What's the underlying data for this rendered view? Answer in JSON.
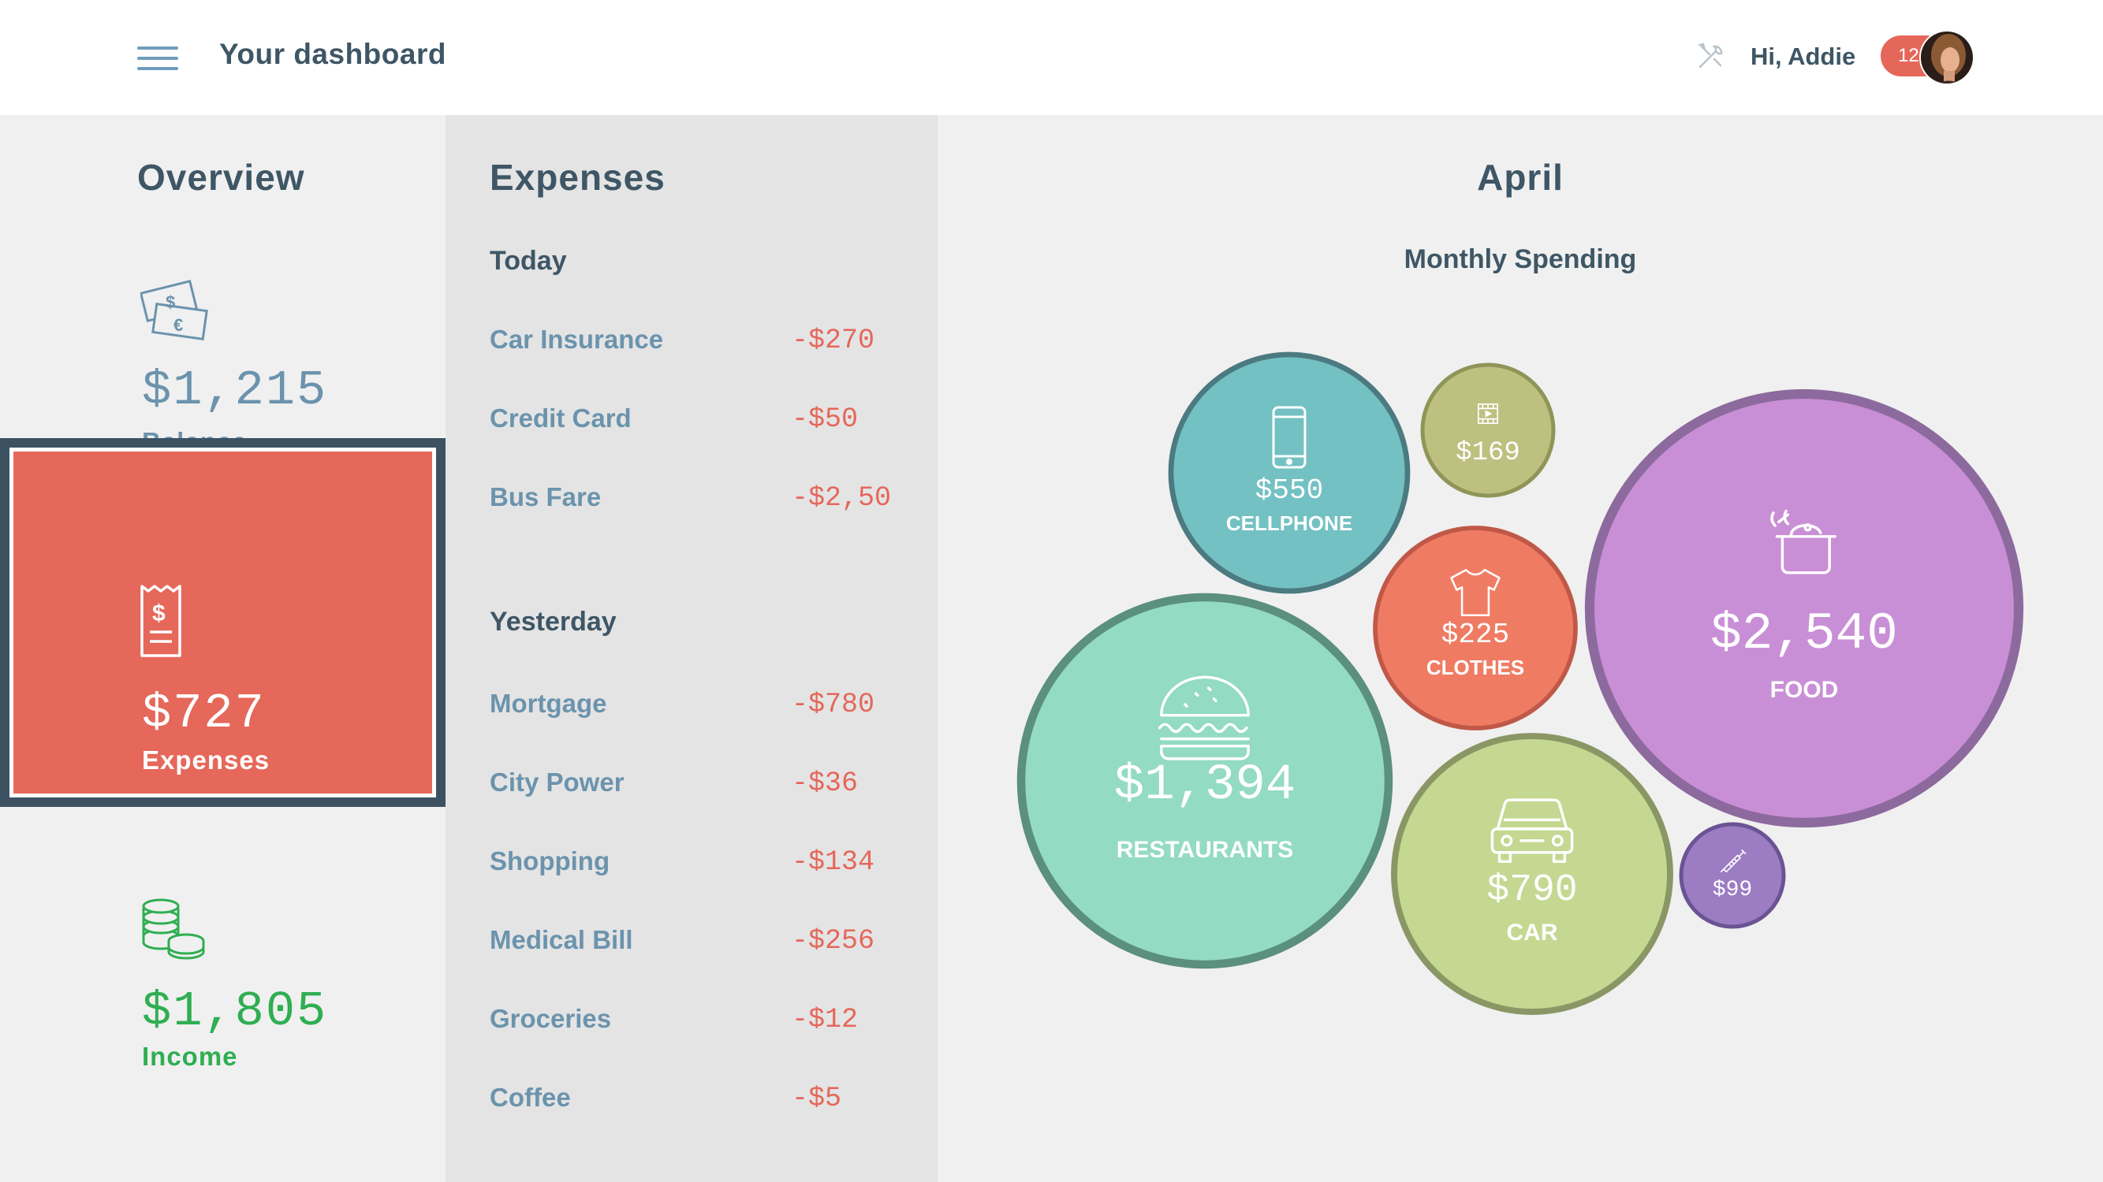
{
  "header": {
    "title": "Your dashboard",
    "greeting": "Hi, Addie",
    "notification_count": "12"
  },
  "overview": {
    "title": "Overview",
    "balance": {
      "value": "$1,215",
      "label": "Balance"
    },
    "expenses": {
      "value": "$727",
      "label": "Expenses"
    },
    "income": {
      "value": "$1,805",
      "label": "Income"
    }
  },
  "expenses": {
    "title": "Expenses",
    "today": {
      "label": "Today",
      "items": [
        {
          "name": "Car Insurance",
          "amount": "-$270"
        },
        {
          "name": "Credit Card",
          "amount": "-$50"
        },
        {
          "name": "Bus Fare",
          "amount": "-$2,50"
        }
      ]
    },
    "yesterday": {
      "label": "Yesterday",
      "items": [
        {
          "name": "Mortgage",
          "amount": "-$780"
        },
        {
          "name": "City Power",
          "amount": "-$36"
        },
        {
          "name": "Shopping",
          "amount": "-$134"
        },
        {
          "name": "Medical Bill",
          "amount": "-$256"
        },
        {
          "name": "Groceries",
          "amount": "-$12"
        },
        {
          "name": "Coffee",
          "amount": "-$5"
        }
      ]
    }
  },
  "chart": {
    "month": "April",
    "subtitle": "Monthly Spending"
  },
  "chart_data": {
    "type": "bubble",
    "title": "Monthly Spending",
    "items": [
      {
        "name": "CELLPHONE",
        "value": 550,
        "label": "$550",
        "icon": "phone-icon",
        "color": "#73c1c2",
        "ring": "#4b7a80"
      },
      {
        "name": "",
        "value": 169,
        "label": "$169",
        "icon": "film-icon",
        "color": "#bec080",
        "ring": "#8f9558"
      },
      {
        "name": "FOOD",
        "value": 2540,
        "label": "$2,540",
        "icon": "cooking-pot-icon",
        "color": "#c98fd6",
        "ring": "#8d6a9e"
      },
      {
        "name": "CLOTHES",
        "value": 225,
        "label": "$225",
        "icon": "shirt-icon",
        "color": "#f07b63",
        "ring": "#c05848"
      },
      {
        "name": "RESTAURANTS",
        "value": 1394,
        "label": "$1,394",
        "icon": "burger-icon",
        "color": "#93dbc3",
        "ring": "#5b8f7e"
      },
      {
        "name": "CAR",
        "value": 790,
        "label": "$790",
        "icon": "car-icon",
        "color": "#c5d892",
        "ring": "#8a9765"
      },
      {
        "name": "",
        "value": 99,
        "label": "$99",
        "icon": "syringe-icon",
        "color": "#9c7cc3",
        "ring": "#6a5494"
      }
    ]
  },
  "colors": {
    "accent_red": "#e5675a",
    "text_dark": "#3e5665",
    "text_blue": "#6b93ad",
    "income_green": "#2fae52"
  }
}
